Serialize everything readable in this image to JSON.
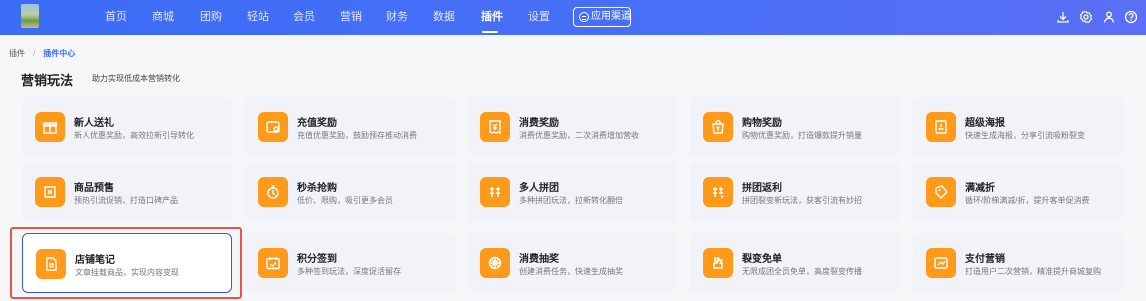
{
  "header": {
    "nav": [
      {
        "label": "首页",
        "active": false
      },
      {
        "label": "商城",
        "active": false
      },
      {
        "label": "团购",
        "active": false
      },
      {
        "label": "轻站",
        "active": false
      },
      {
        "label": "会员",
        "active": false
      },
      {
        "label": "营销",
        "active": false
      },
      {
        "label": "财务",
        "active": false
      },
      {
        "label": "数据",
        "active": false
      },
      {
        "label": "插件",
        "active": true
      },
      {
        "label": "设置",
        "active": false
      }
    ],
    "app_channel_label": "应用渠道",
    "tools": [
      "download-icon",
      "gear-icon",
      "user-icon",
      "help-icon"
    ]
  },
  "breadcrumb": {
    "root": "插件",
    "current": "插件中心"
  },
  "section": {
    "title": "营销玩法",
    "subtitle": "助力实现低成本营销转化"
  },
  "colors": {
    "header": "#3b6cf6",
    "icon_bg": "#ff9a1b",
    "selected_border": "#3b56d8",
    "highlight_frame": "#e8534a"
  },
  "cards": [
    {
      "title": "新人送礼",
      "desc": "新人优惠奖励，高效拉新引导转化",
      "icon": "gift-box-icon"
    },
    {
      "title": "充值奖励",
      "desc": "充值优惠奖励，鼓励预存推动消费",
      "icon": "wallet-icon"
    },
    {
      "title": "消费奖励",
      "desc": "消费优惠奖励，二次消费增加营收",
      "icon": "receipt-yuan-icon"
    },
    {
      "title": "购物奖励",
      "desc": "购物优惠奖励，打造爆款提升销量",
      "icon": "bag-yuan-icon"
    },
    {
      "title": "超级海报",
      "desc": "快速生成海报，分享引流吸粉裂变",
      "icon": "poster-icon"
    },
    {
      "title": "商品预售",
      "desc": "预热引流促销，打造口碑产品",
      "icon": "presale-icon"
    },
    {
      "title": "秒杀抢购",
      "desc": "低价、限购，吸引更多会员",
      "icon": "stopwatch-icon"
    },
    {
      "title": "多人拼团",
      "desc": "多种拼团玩法，拉新转化翻倍",
      "icon": "group-buy-icon"
    },
    {
      "title": "拼团返利",
      "desc": "拼团裂变新玩法，获客引流有妙招",
      "icon": "group-rebate-icon"
    },
    {
      "title": "满减折",
      "desc": "循环/阶梯满减/折，提升客单促消费",
      "icon": "discount-tag-icon"
    },
    {
      "title": "店铺笔记",
      "desc": "文章挂载商品，实现内容变现",
      "icon": "note-icon",
      "selected": true
    },
    {
      "title": "积分签到",
      "desc": "多种签到玩法，深度促活留存",
      "icon": "calendar-check-icon"
    },
    {
      "title": "消费抽奖",
      "desc": "创建消费任务，快速生成抽奖",
      "icon": "lottery-icon"
    },
    {
      "title": "裂变免单",
      "desc": "无限成团全员免单，高度裂变传播",
      "icon": "free-order-icon"
    },
    {
      "title": "支付营销",
      "desc": "打造用户二次营销，精准提升商城复购",
      "icon": "payment-icon"
    }
  ]
}
